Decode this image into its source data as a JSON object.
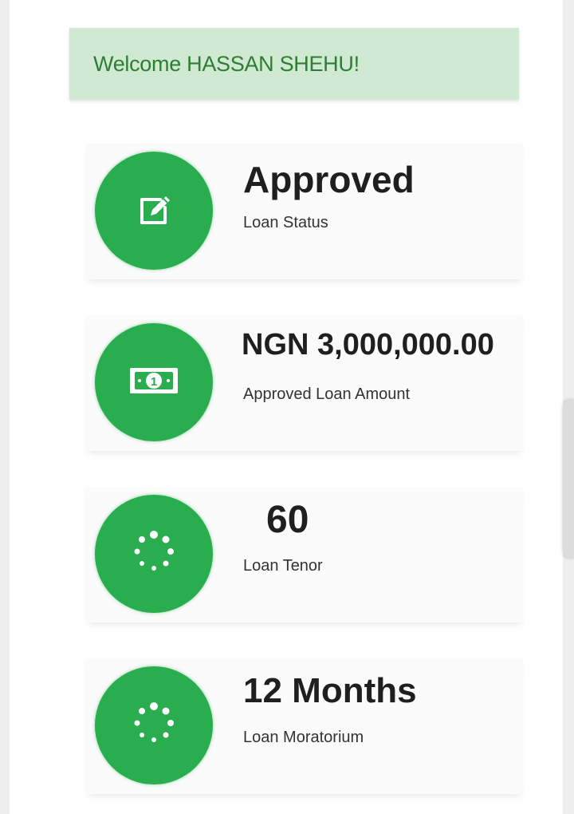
{
  "welcome": {
    "text": "Welcome HASSAN SHEHU!"
  },
  "cards": [
    {
      "value": "Approved",
      "label": "Loan Status",
      "icon": "edit-icon"
    },
    {
      "value": "NGN 3,000,000.00",
      "label": "Approved Loan Amount",
      "icon": "money-icon"
    },
    {
      "value": "60",
      "label": "Loan Tenor",
      "icon": "spinner-icon"
    },
    {
      "value": "12 Months",
      "label": "Loan Moratorium",
      "icon": "spinner-icon"
    }
  ],
  "colors": {
    "accent": "#2aad4f",
    "banner_bg": "#cfe9d3",
    "banner_text": "#2e7d32"
  }
}
